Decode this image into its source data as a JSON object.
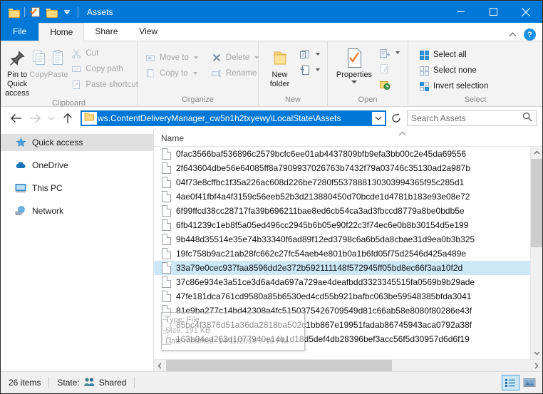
{
  "window": {
    "title": "Assets",
    "quick_access_icons": [
      "folder-icon",
      "properties-icon",
      "folder-icon",
      "customize-qat-caret"
    ],
    "controls": {
      "minimize": "minimize-icon",
      "maximize": "maximize-icon",
      "close": "close-icon"
    },
    "accent_color": "#0078d7"
  },
  "tabs": {
    "file": "File",
    "items": [
      {
        "label": "Home",
        "active": true
      },
      {
        "label": "Share",
        "active": false
      },
      {
        "label": "View",
        "active": false
      }
    ],
    "collapse_ribbon": "chevron-up-icon",
    "help": "?"
  },
  "ribbon": {
    "groups": [
      {
        "title": "Clipboard",
        "big": [
          {
            "label": "Pin to Quick access",
            "icon": "pin-icon",
            "dim": false
          },
          {
            "label": "Copy",
            "icon": "copy-icon",
            "dim": true
          },
          {
            "label": "Paste",
            "icon": "paste-icon",
            "dim": true
          }
        ],
        "small": [
          {
            "label": "Cut",
            "icon": "scissors-icon",
            "dim": true
          },
          {
            "label": "Copy path",
            "icon": "copy-path-icon",
            "dim": true
          },
          {
            "label": "Paste shortcut",
            "icon": "paste-shortcut-icon",
            "dim": true
          }
        ]
      },
      {
        "title": "Organize",
        "small_left": [
          {
            "label": "Move to",
            "icon": "move-to-icon",
            "dim": true,
            "caret": true
          },
          {
            "label": "Copy to",
            "icon": "copy-to-icon",
            "dim": true,
            "caret": true
          }
        ],
        "small_right": [
          {
            "label": "Delete",
            "icon": "delete-icon",
            "dim": true,
            "caret": true
          },
          {
            "label": "Rename",
            "icon": "rename-icon",
            "dim": true,
            "caret": false
          }
        ]
      },
      {
        "title": "New",
        "big": [
          {
            "label": "New folder",
            "icon": "new-folder-icon",
            "dim": false
          }
        ],
        "small": [
          {
            "label": "",
            "icon": "new-item-icon",
            "dim": false,
            "caret": true
          },
          {
            "label": "",
            "icon": "easy-access-icon",
            "dim": false,
            "caret": true
          }
        ]
      },
      {
        "title": "Open",
        "big": [
          {
            "label": "Properties",
            "icon": "properties-icon",
            "dim": false,
            "caret": true
          }
        ],
        "small": [
          {
            "label": "",
            "icon": "open-icon",
            "dim": false,
            "caret": true
          },
          {
            "label": "",
            "icon": "edit-icon",
            "dim": true,
            "caret": false
          },
          {
            "label": "",
            "icon": "history-icon",
            "dim": false,
            "caret": false
          }
        ]
      },
      {
        "title": "Select",
        "small": [
          {
            "label": "Select all",
            "icon": "select-all-icon",
            "dim": false
          },
          {
            "label": "Select none",
            "icon": "select-none-icon",
            "dim": false
          },
          {
            "label": "Invert selection",
            "icon": "invert-selection-icon",
            "dim": false
          }
        ]
      }
    ]
  },
  "address": {
    "back": "back-arrow-icon",
    "forward": "forward-arrow-icon",
    "recent": "chevron-down-icon",
    "up": "up-arrow-icon",
    "path_text": "ws.ContentDeliveryManager_cw5n1h2txyewy\\LocalState\\Assets",
    "path_selected": true,
    "dropdown": "chevron-down-icon",
    "refresh": "refresh-icon",
    "search_placeholder": "Search Assets",
    "search_value": "",
    "search_icon": "search-icon"
  },
  "sidebar": {
    "items": [
      {
        "label": "Quick access",
        "icon": "star-pin-icon",
        "selected": true
      },
      {
        "label": "OneDrive",
        "icon": "onedrive-cloud-icon",
        "selected": false
      },
      {
        "label": "This PC",
        "icon": "monitor-icon",
        "selected": false
      },
      {
        "label": "Network",
        "icon": "network-icon",
        "selected": false
      }
    ]
  },
  "filelist": {
    "column_header": "Name",
    "sort_indicator": "sort-ascending-icon",
    "rows": [
      {
        "name": "0fac3566baf536896c2579bcfc6ee01ab4437809bfb9efa3bb00c2e45da69556",
        "selected": false
      },
      {
        "name": "2f643604dbe56e64085ff8a7909937026763b7432f79a03746c35130ad2a987b",
        "selected": false
      },
      {
        "name": "04f73e8cffbc1f35a226ac608d226be7280f5537888130303994365f95c285d1",
        "selected": false
      },
      {
        "name": "4ae0f41fbf4a4f3159c56eeb52b3d213880450d70bcde1d4781b183e93e08e72",
        "selected": false
      },
      {
        "name": "6f99ffcd38cc28717fa39b696211bae8ed6cb54ca3ad3fbccd8779a8be0bdb5e",
        "selected": false
      },
      {
        "name": "6fb41239c1eb8f5a05ed496cc2945b6b05e90f22c3f74ec6e0b8b30154d5e199",
        "selected": false
      },
      {
        "name": "9b448d35514e35e74b33340f6ad89f12ed3798c6a6b5da8cbae31d9ea0b3b325",
        "selected": false
      },
      {
        "name": "19fc758b9ac21ab28fc662c27fc54aeb4e801b0a1b6fd05f75d2546d425a489e",
        "selected": false
      },
      {
        "name": "33a79e0cec937faa8596dd2e372b592111148f572945ff05bd8ec66f3aa10f2d",
        "selected": true
      },
      {
        "name": "37c86e934e3a51ce3d6a4da697a729ae4deafbdd3323345515fa0569b9b29ade",
        "selected": false
      },
      {
        "name": "47fe181dca761cd9580a85b6530ed4cd55b921bafbc063be59548385bfda3041",
        "selected": false
      },
      {
        "name": "81e9ba277c14bd42308a4fc5150375426709549d81c66ab58e8080f80286e43f",
        "selected": false
      },
      {
        "name": "85bc4f3876d51a36da2818ba502c1bb867e19951fadab86745943aca0792a38f",
        "selected": false
      },
      {
        "name": "163b04cd263d1077940e14b1d18d5def4db28396bef3acc56f5d30957d6d6f19",
        "selected": false
      }
    ],
    "tooltip": {
      "type_line": "Type: File",
      "size_line": "Size: 191 KB",
      "date_line": "Date modified: 14/11/2016 7:16 PM"
    }
  },
  "statusbar": {
    "item_count": "26 items",
    "state_label": "State:",
    "state_value": "Shared",
    "state_icon": "shared-people-icon",
    "views": [
      {
        "name": "details-view",
        "active": true
      },
      {
        "name": "large-icons-view",
        "active": false
      }
    ]
  }
}
